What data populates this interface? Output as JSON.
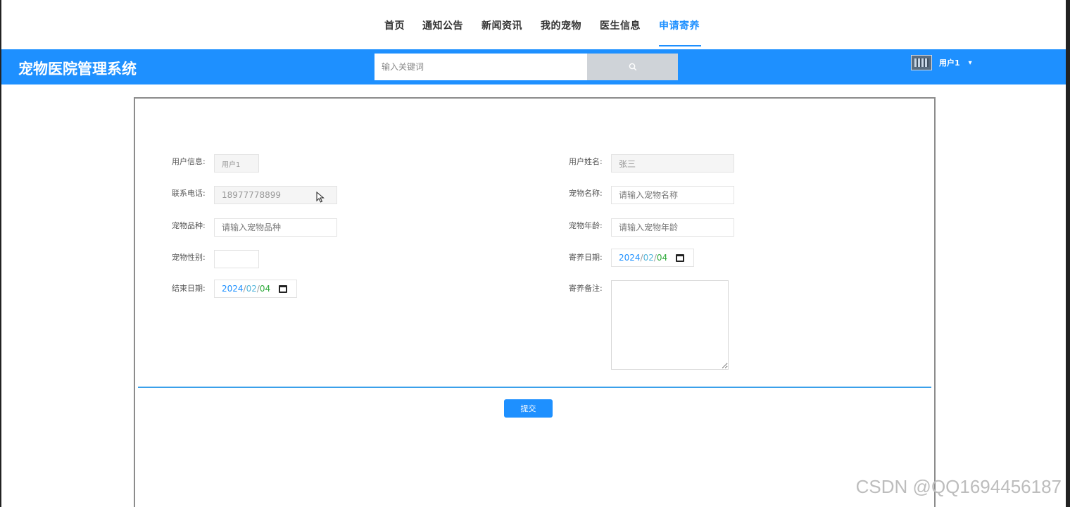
{
  "nav": {
    "items": [
      {
        "label": "首页"
      },
      {
        "label": "通知公告"
      },
      {
        "label": "新闻资讯"
      },
      {
        "label": "我的宠物"
      },
      {
        "label": "医生信息"
      },
      {
        "label": "申请寄养"
      }
    ],
    "active_index": 5
  },
  "header": {
    "title": "宠物医院管理系统",
    "search_placeholder": "输入关键词",
    "user_name": "用户1",
    "caret": "▾"
  },
  "form": {
    "user_info": {
      "label": "用户信息:",
      "value": "用户1"
    },
    "user_name": {
      "label": "用户姓名:",
      "value": "张三"
    },
    "phone": {
      "label": "联系电话:",
      "value": "18977778899"
    },
    "pet_name": {
      "label": "宠物名称:",
      "placeholder": "请输入宠物名称"
    },
    "pet_breed": {
      "label": "宠物品种:",
      "placeholder": "请输入宠物品种"
    },
    "pet_age": {
      "label": "宠物年龄:",
      "placeholder": "请输入宠物年龄"
    },
    "pet_gender": {
      "label": "宠物性别:",
      "value": ""
    },
    "board_date": {
      "label": "寄养日期:",
      "year": "2024",
      "month": "02",
      "day": "04"
    },
    "end_date": {
      "label": "结束日期:",
      "year": "2024",
      "month": "02",
      "day": "04"
    },
    "remark": {
      "label": "寄养备注:"
    },
    "submit_label": "提交"
  },
  "watermark": "CSDN @QQ1694456187",
  "colors": {
    "accent": "#1e90ff",
    "divider": "#3aa0ea",
    "search_button": "#cfd3d8"
  }
}
